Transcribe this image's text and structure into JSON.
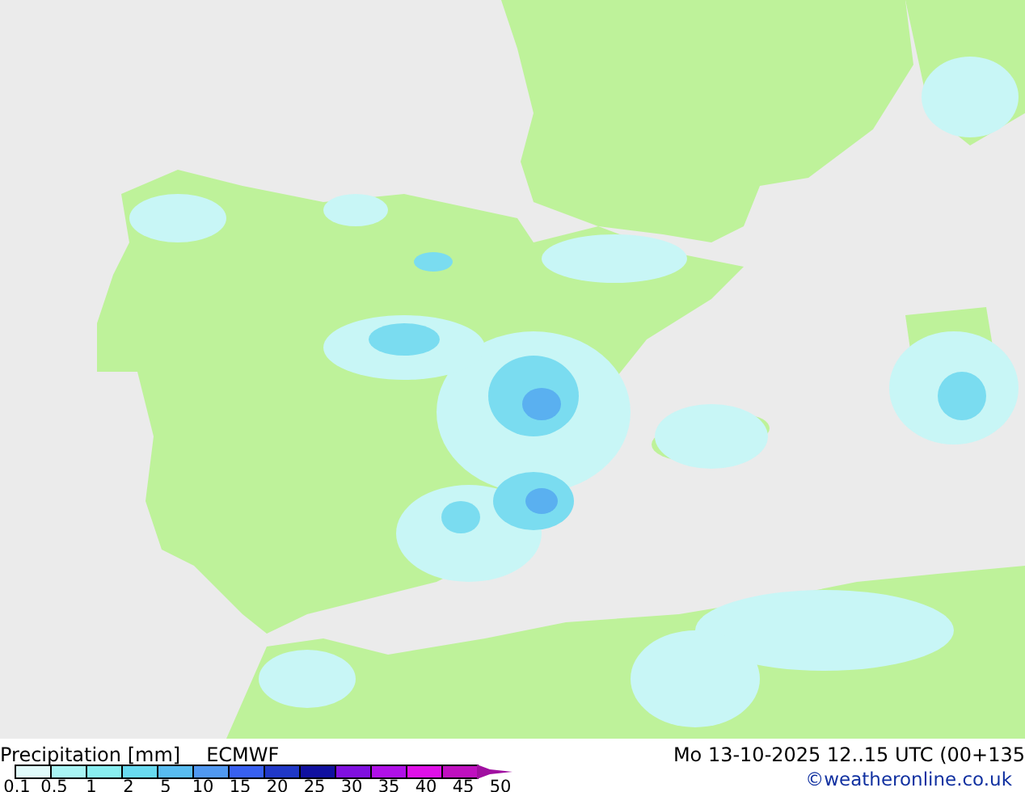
{
  "legend": {
    "title": "Precipitation [mm]",
    "model": "ECMWF",
    "swatches": [
      {
        "color": "#e0fafa"
      },
      {
        "color": "#a8f4f4"
      },
      {
        "color": "#88eef0"
      },
      {
        "color": "#68daf0"
      },
      {
        "color": "#58bcf0"
      },
      {
        "color": "#5098f0"
      },
      {
        "color": "#3860f0"
      },
      {
        "color": "#2038c8"
      },
      {
        "color": "#1010a0"
      },
      {
        "color": "#8010e0"
      },
      {
        "color": "#b010e8"
      },
      {
        "color": "#e010e8"
      },
      {
        "color": "#c010c0"
      },
      {
        "color": "#a010a0",
        "kind": "arrow"
      }
    ],
    "labels": [
      "0.1",
      "0.5",
      "1",
      "2",
      "5",
      "10",
      "15",
      "20",
      "25",
      "30",
      "35",
      "40",
      "45",
      "50"
    ]
  },
  "valid_time": "Mo 13-10-2025 12..15 UTC (00+135",
  "credit": "©weatheronline.co.uk"
}
